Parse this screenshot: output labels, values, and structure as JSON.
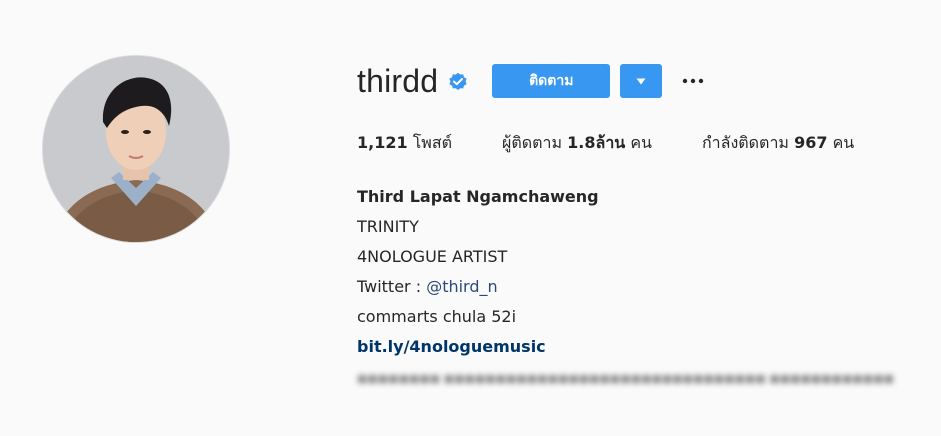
{
  "profile": {
    "username": "thirdd",
    "follow_label": "ติดตาม",
    "dropdown_icon": "caret-down-icon",
    "more_icon": "more-options-icon"
  },
  "stats": {
    "posts_count": "1,121",
    "posts_label": "โพสต์",
    "followers_prefix": "ผู้ติดตาม",
    "followers_count": "1.8ล้าน",
    "followers_suffix": "คน",
    "following_prefix": "กำลังติดตาม",
    "following_count": "967",
    "following_suffix": "คน"
  },
  "bio": {
    "full_name": "Third Lapat Ngamchaweng",
    "line1": "TRINITY",
    "line2": "4NOLOGUE ARTIST",
    "twitter_prefix": "Twitter : ",
    "twitter_handle": "@third_n",
    "line4": "commarts chula 52i",
    "link": "bit.ly/4nologuemusic"
  },
  "colors": {
    "accent": "#3897f0",
    "link": "#003569",
    "verified": "#3897f0"
  }
}
